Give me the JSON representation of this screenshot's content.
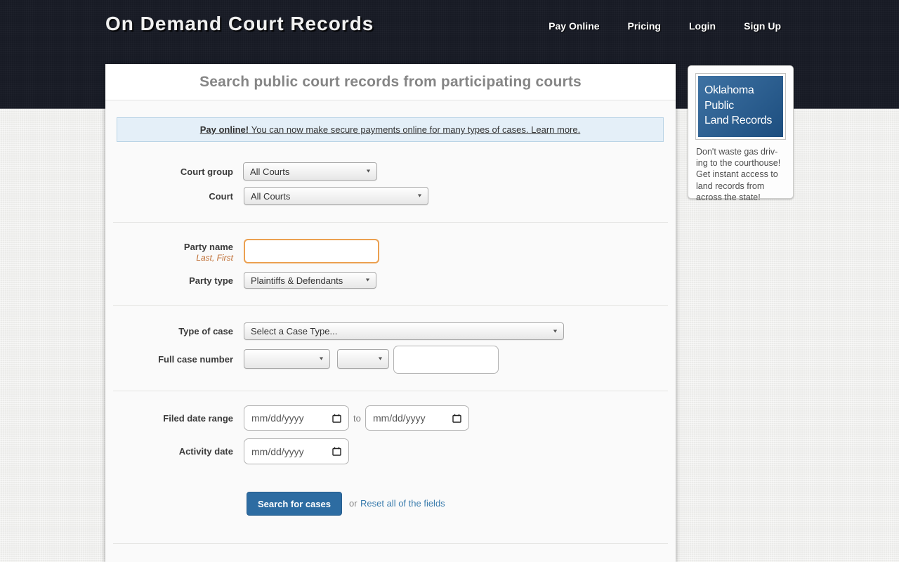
{
  "header": {
    "logo": "On Demand Court Records",
    "nav": [
      {
        "label": "Pay Online"
      },
      {
        "label": "Pricing"
      },
      {
        "label": "Login"
      },
      {
        "label": "Sign Up"
      }
    ]
  },
  "main": {
    "title": "Search public court records from participating courts",
    "banner": {
      "lead": "Pay online!",
      "body": " You can now make secure payments online for many types of cases. ",
      "link": "Learn more."
    },
    "form": {
      "court_group_label": "Court group",
      "court_group_value": "All Courts",
      "court_label": "Court",
      "court_value": "All Courts",
      "party_name_label": "Party name",
      "party_name_hint": "Last, First",
      "party_name_value": "",
      "party_type_label": "Party type",
      "party_type_value": "Plaintiffs & Defendants",
      "case_type_label": "Type of case",
      "case_type_value": "Select a Case Type...",
      "case_number_label": "Full case number",
      "case_dd1_value": "",
      "case_dd2_value": "",
      "case_number_value": "",
      "filed_date_label": "Filed date range",
      "date_placeholder": "mm/dd/yyyy",
      "date_separator": "to",
      "activity_date_label": "Activity date",
      "search_button": "Search for cases",
      "or_text": "or",
      "reset_link": "Reset all of the fields"
    }
  },
  "sidebar": {
    "title_lines": [
      "Oklahoma",
      "Public",
      "Land Records"
    ],
    "text_lines": [
      "Don't waste gas driv-",
      "ing to the courthouse!",
      "Get instant access to",
      "land records from",
      "across the state!"
    ]
  },
  "colors": {
    "header_bg": "#171a24",
    "page_bg": "#ebebe9",
    "accent_blue": "#2d6ca2",
    "link_blue": "#3a7cad",
    "hint_orange": "#bd6a2e",
    "focus_orange": "#eba050",
    "banner_bg": "#e4eff8",
    "banner_border": "#bad4e6",
    "ad_blue_top": "#3e72a3",
    "ad_blue_bottom": "#1d4e7f"
  }
}
